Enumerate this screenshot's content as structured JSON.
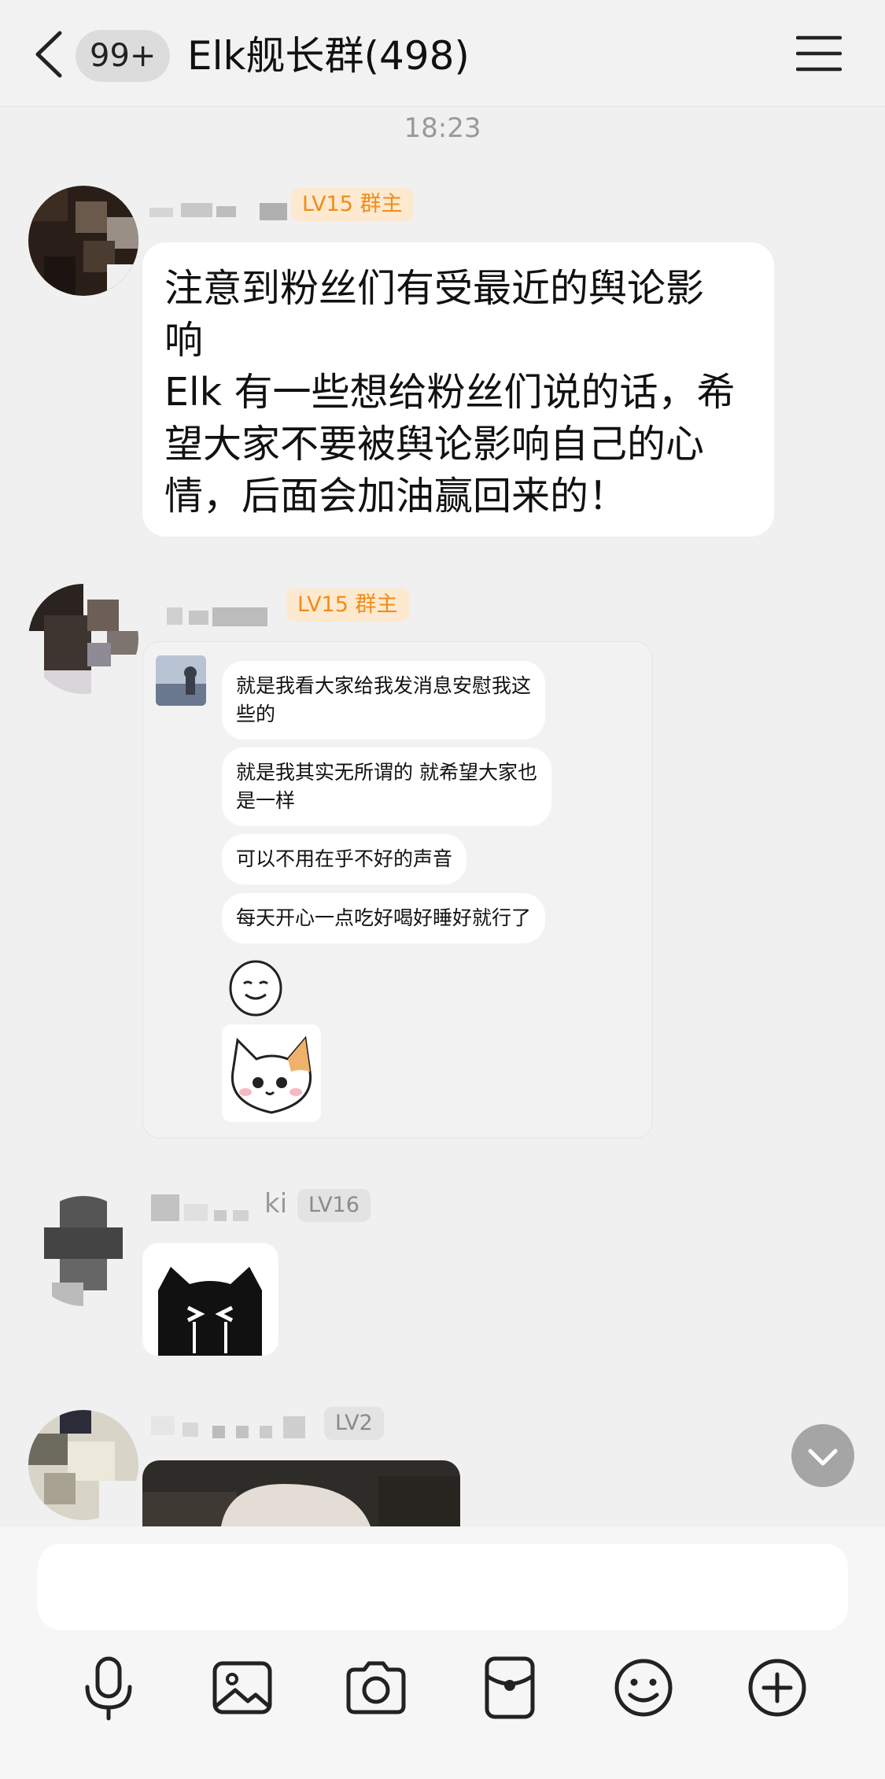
{
  "header": {
    "unread_count": "99+",
    "title": "Elk舰长群(498)"
  },
  "timestamp": "18:23",
  "messages": [
    {
      "badge": "LV15 群主",
      "lines": [
        "注意到粉丝们有受最近的舆论影",
        "响",
        "Elk 有一些想给粉丝们说的话，希",
        "望大家不要被舆论影响自己的心",
        "情，后面会加油赢回来的！"
      ]
    },
    {
      "badge": "LV15 群主",
      "forwarded": [
        {
          "lines": [
            "就是我看大家给我发消息安慰我这",
            "些的"
          ]
        },
        {
          "lines": [
            "就是我其实无所谓的 就希望大家也",
            "是一样"
          ]
        },
        {
          "lines": [
            "可以不用在乎不好的声音"
          ]
        },
        {
          "lines": [
            "每天开心一点吃好喝好睡好就行了"
          ]
        }
      ]
    },
    {
      "name_fragment": "ki",
      "badge": "LV16"
    },
    {
      "badge": "LV2"
    }
  ],
  "input": {
    "placeholder": ""
  },
  "icons": [
    "chevron-left-icon",
    "menu-icon",
    "microphone-icon",
    "image-icon",
    "camera-icon",
    "red-packet-icon",
    "emoji-icon",
    "plus-icon",
    "chevron-down-icon"
  ],
  "colors": {
    "owner_badge_bg": "#fde9cf",
    "owner_badge_text": "#f08c19",
    "level_badge_bg": "#e3e3e3"
  }
}
